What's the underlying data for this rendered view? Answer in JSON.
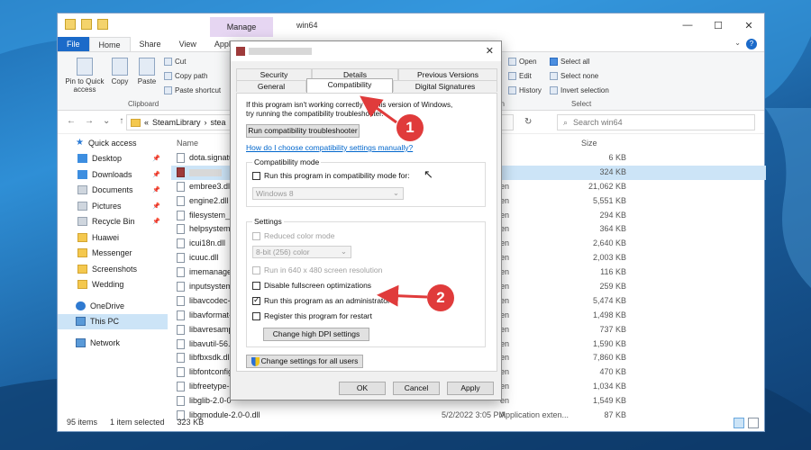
{
  "explorer": {
    "title": "win64",
    "context_tab": "Manage",
    "ribbon_tabs": [
      "File",
      "Home",
      "Share",
      "View",
      "Application Tools"
    ],
    "clipboard": {
      "pin_label": "Pin to Quick access",
      "copy": "Copy",
      "paste": "Paste",
      "cut": "Cut",
      "copy_path": "Copy path",
      "paste_shortcut": "Paste shortcut",
      "group": "Clipboard"
    },
    "open_group": {
      "open": "Open",
      "edit": "Edit",
      "history": "History",
      "group": "en"
    },
    "select_group": {
      "select_all": "Select all",
      "select_none": "Select none",
      "invert": "Invert selection",
      "group": "Select"
    },
    "address": {
      "prefix": "«",
      "path1": "SteamLibrary",
      "path2": "stea"
    },
    "search_placeholder": "Search win64",
    "columns": {
      "name": "Name",
      "size": "Size"
    },
    "nav": [
      {
        "label": "Quick access",
        "icon": "star"
      },
      {
        "label": "Desktop",
        "icon": "blue",
        "pin": "📌"
      },
      {
        "label": "Downloads",
        "icon": "blue",
        "pin": "📌"
      },
      {
        "label": "Documents",
        "icon": "gray",
        "pin": "📌"
      },
      {
        "label": "Pictures",
        "icon": "gray",
        "pin": "📌"
      },
      {
        "label": "Recycle Bin",
        "icon": "gray",
        "pin": "📌"
      },
      {
        "label": "Huawei",
        "icon": "folder"
      },
      {
        "label": "Messenger",
        "icon": "folder"
      },
      {
        "label": "Screenshots",
        "icon": "folder"
      },
      {
        "label": "Wedding",
        "icon": "folder"
      },
      {
        "label": "OneDrive",
        "icon": "cloud"
      },
      {
        "label": "This PC",
        "icon": "pc"
      },
      {
        "label": "Network",
        "icon": "pc"
      }
    ],
    "files": [
      {
        "name": "dota.signatu",
        "date": "",
        "type": "",
        "size": "6 KB"
      },
      {
        "name": "",
        "date": "",
        "type": "",
        "size": "324 KB"
      },
      {
        "name": "embree3.dll",
        "date": "",
        "type": "en",
        "size": "21,062 KB"
      },
      {
        "name": "engine2.dll",
        "date": "",
        "type": "en",
        "size": "5,551 KB"
      },
      {
        "name": "filesystem_st",
        "date": "",
        "type": "en",
        "size": "294 KB"
      },
      {
        "name": "helpsystem.",
        "date": "",
        "type": "en",
        "size": "364 KB"
      },
      {
        "name": "icui18n.dll",
        "date": "",
        "type": "en",
        "size": "2,640 KB"
      },
      {
        "name": "icuuc.dll",
        "date": "",
        "type": "en",
        "size": "2,003 KB"
      },
      {
        "name": "imemanager",
        "date": "",
        "type": "en",
        "size": "116 KB"
      },
      {
        "name": "inputsystem",
        "date": "",
        "type": "en",
        "size": "259 KB"
      },
      {
        "name": "libavcodec-5",
        "date": "",
        "type": "en",
        "size": "5,474 KB"
      },
      {
        "name": "libavformat-",
        "date": "",
        "type": "en",
        "size": "1,498 KB"
      },
      {
        "name": "libavresamp",
        "date": "",
        "type": "en",
        "size": "737 KB"
      },
      {
        "name": "libavutil-56.",
        "date": "",
        "type": "en",
        "size": "1,590 KB"
      },
      {
        "name": "libfbxsdk.dll",
        "date": "",
        "type": "en",
        "size": "7,860 KB"
      },
      {
        "name": "libfontconfig",
        "date": "",
        "type": "en",
        "size": "470 KB"
      },
      {
        "name": "libfreetype-6",
        "date": "",
        "type": "en",
        "size": "1,034 KB"
      },
      {
        "name": "libglib-2.0-0",
        "date": "",
        "type": "en",
        "size": "1,549 KB"
      },
      {
        "name": "libgmodule-2.0-0.dll",
        "date": "5/2/2022 3:05 PM",
        "type": "Application exten...",
        "size": "87 KB"
      }
    ],
    "status": {
      "count": "95 items",
      "selected": "1 item selected",
      "size": "323 KB"
    }
  },
  "dialog": {
    "tabs_row1": [
      "Security",
      "Details",
      "Previous Versions"
    ],
    "tabs_row2": [
      "General",
      "Compatibility",
      "Digital Signatures"
    ],
    "intro_line1": "If this program isn't working correctly on this version of Windows,",
    "intro_line2": "try running the compatibility troubleshooter.",
    "troubleshooter_btn": "Run compatibility troubleshooter",
    "help_link": "How do I choose compatibility settings manually?",
    "compat_mode": {
      "title": "Compatibility mode",
      "checkbox": "Run this program in compatibility mode for:",
      "select": "Windows 8"
    },
    "settings": {
      "title": "Settings",
      "reduced_color": "Reduced color mode",
      "color_select": "8-bit (256) color",
      "run_640": "Run in 640 x 480 screen resolution",
      "disable_fullscreen": "Disable fullscreen optimizations",
      "run_admin": "Run this program as an administrator",
      "register_restart": "Register this program for restart",
      "dpi_btn": "Change high DPI settings"
    },
    "all_users_btn": "Change settings for all users",
    "ok": "OK",
    "cancel": "Cancel",
    "apply": "Apply"
  },
  "annotations": {
    "badge1": "1",
    "badge2": "2",
    "color": "#e03b3b"
  }
}
